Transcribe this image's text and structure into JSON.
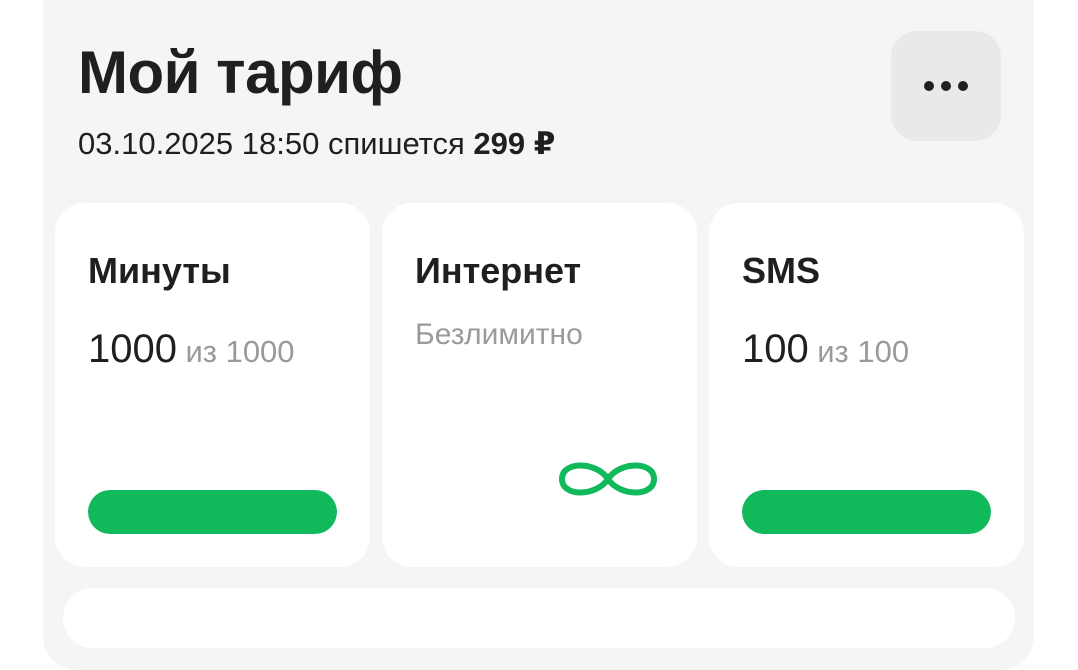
{
  "header": {
    "title": "Мой тариф",
    "charge_date": "03.10.2025 18:50",
    "charge_text": "спишется",
    "charge_amount": "299 ₽",
    "more_icon": "more-horizontal-icon"
  },
  "cards": {
    "minutes": {
      "title": "Минуты",
      "remaining": "1000",
      "of_label": "из 1000",
      "progress": 1.0
    },
    "internet": {
      "title": "Интернет",
      "status": "Безлимитно",
      "icon": "infinity-icon"
    },
    "sms": {
      "title": "SMS",
      "remaining": "100",
      "of_label": "из 100",
      "progress": 1.0
    }
  },
  "colors": {
    "accent": "#10b95a",
    "panel_bg": "#f5f5f5",
    "text_primary": "#1f1f1f",
    "text_secondary": "#9a9a9a"
  }
}
